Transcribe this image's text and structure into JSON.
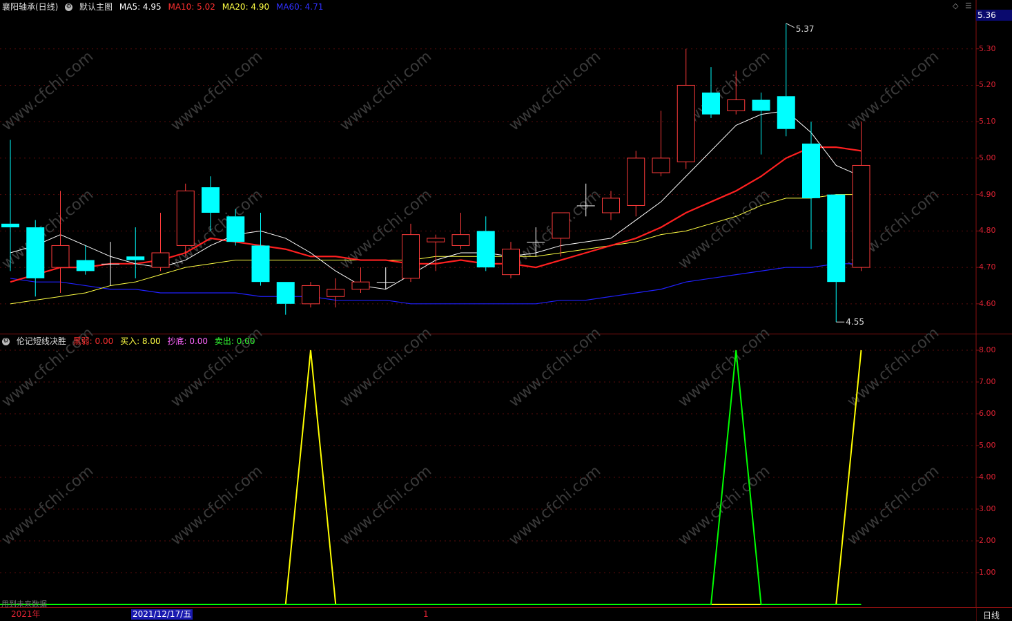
{
  "main_header": {
    "stock_name": "襄阳轴承(日线)",
    "chart_label": "默认主图",
    "ma5": "MA5: 4.95",
    "ma10": "MA10: 5.02",
    "ma20": "MA20: 4.90",
    "ma60": "MA60: 4.71"
  },
  "indicator_header": {
    "name": "伦记短线决胜",
    "black_horse": "黑弱: 0.00",
    "buy": "买入: 8.00",
    "bottom": "抄底: 0.00",
    "sell": "卖出: 0.00"
  },
  "current_price": "5.36",
  "price_ticks": [
    "5.30",
    "5.20",
    "5.10",
    "5.00",
    "4.90",
    "4.80",
    "4.70",
    "4.60"
  ],
  "indicator_ticks": [
    "8.00",
    "7.00",
    "6.00",
    "5.00",
    "4.00",
    "3.00",
    "2.00",
    "1.00"
  ],
  "high_mark": "5.37",
  "low_mark": "4.55",
  "watermark": "www.cfchi.com",
  "footer": {
    "year": "2021年",
    "cursor_date": "2021/12/17/五",
    "month_mark": "1",
    "future_note": "用到未来数据",
    "period": "日线"
  },
  "controls": {
    "diamond": "◇",
    "menu": "☰"
  },
  "colors": {
    "up": "#ff3b3b",
    "down": "#00ffff",
    "ma5": "#ffffff",
    "ma10": "#ff2020",
    "ma20": "#ffff44",
    "ma60": "#2020ff",
    "buy": "#ffff00",
    "sell": "#00ff00",
    "axis": "#8a1010"
  },
  "chart_data": [
    {
      "type": "candlestick",
      "title": "襄阳轴承(日线)",
      "ylim": [
        4.52,
        5.4
      ],
      "candles": [
        {
          "o": 4.82,
          "h": 5.05,
          "l": 4.69,
          "c": 4.81
        },
        {
          "o": 4.81,
          "h": 4.83,
          "l": 4.62,
          "c": 4.67
        },
        {
          "o": 4.7,
          "h": 4.91,
          "l": 4.63,
          "c": 4.76
        },
        {
          "o": 4.72,
          "h": 4.76,
          "l": 4.68,
          "c": 4.69
        },
        {
          "o": 4.71,
          "h": 4.77,
          "l": 4.65,
          "c": 4.71
        },
        {
          "o": 4.73,
          "h": 4.81,
          "l": 4.67,
          "c": 4.72
        },
        {
          "o": 4.7,
          "h": 4.85,
          "l": 4.69,
          "c": 4.74
        },
        {
          "o": 4.76,
          "h": 4.93,
          "l": 4.73,
          "c": 4.91
        },
        {
          "o": 4.92,
          "h": 4.95,
          "l": 4.8,
          "c": 4.85
        },
        {
          "o": 4.84,
          "h": 4.86,
          "l": 4.76,
          "c": 4.77
        },
        {
          "o": 4.76,
          "h": 4.85,
          "l": 4.65,
          "c": 4.66
        },
        {
          "o": 4.66,
          "h": 4.66,
          "l": 4.57,
          "c": 4.6
        },
        {
          "o": 4.6,
          "h": 4.66,
          "l": 4.59,
          "c": 4.65
        },
        {
          "o": 4.62,
          "h": 4.67,
          "l": 4.59,
          "c": 4.64
        },
        {
          "o": 4.64,
          "h": 4.7,
          "l": 4.63,
          "c": 4.66
        },
        {
          "o": 4.66,
          "h": 4.7,
          "l": 4.64,
          "c": 4.66
        },
        {
          "o": 4.67,
          "h": 4.82,
          "l": 4.66,
          "c": 4.79
        },
        {
          "o": 4.77,
          "h": 4.79,
          "l": 4.69,
          "c": 4.78
        },
        {
          "o": 4.76,
          "h": 4.85,
          "l": 4.75,
          "c": 4.79
        },
        {
          "o": 4.8,
          "h": 4.84,
          "l": 4.69,
          "c": 4.7
        },
        {
          "o": 4.68,
          "h": 4.77,
          "l": 4.67,
          "c": 4.75
        },
        {
          "o": 4.77,
          "h": 4.81,
          "l": 4.73,
          "c": 4.77
        },
        {
          "o": 4.78,
          "h": 4.85,
          "l": 4.73,
          "c": 4.85
        },
        {
          "o": 4.87,
          "h": 4.93,
          "l": 4.84,
          "c": 4.87
        },
        {
          "o": 4.85,
          "h": 4.91,
          "l": 4.83,
          "c": 4.89
        },
        {
          "o": 4.87,
          "h": 5.02,
          "l": 4.84,
          "c": 5.0
        },
        {
          "o": 4.96,
          "h": 5.13,
          "l": 4.95,
          "c": 5.0
        },
        {
          "o": 4.99,
          "h": 5.3,
          "l": 4.97,
          "c": 5.2
        },
        {
          "o": 5.18,
          "h": 5.25,
          "l": 5.11,
          "c": 5.12
        },
        {
          "o": 5.13,
          "h": 5.24,
          "l": 5.12,
          "c": 5.16
        },
        {
          "o": 5.16,
          "h": 5.18,
          "l": 5.01,
          "c": 5.13
        },
        {
          "o": 5.17,
          "h": 5.37,
          "l": 5.06,
          "c": 5.08
        },
        {
          "o": 5.04,
          "h": 5.1,
          "l": 4.75,
          "c": 4.89
        },
        {
          "o": 4.9,
          "h": 4.9,
          "l": 4.55,
          "c": 4.66
        },
        {
          "o": 4.7,
          "h": 5.1,
          "l": 4.69,
          "c": 4.98
        }
      ],
      "ma5": [
        4.74,
        4.76,
        4.79,
        4.76,
        4.73,
        4.71,
        4.7,
        4.72,
        4.76,
        4.79,
        4.8,
        4.78,
        4.74,
        4.69,
        4.65,
        4.64,
        4.68,
        4.72,
        4.74,
        4.74,
        4.73,
        4.74,
        4.76,
        4.77,
        4.78,
        4.83,
        4.88,
        4.95,
        5.02,
        5.09,
        5.12,
        5.13,
        5.07,
        4.98,
        4.95
      ],
      "ma10": [
        4.66,
        4.68,
        4.7,
        4.7,
        4.71,
        4.71,
        4.72,
        4.74,
        4.78,
        4.77,
        4.76,
        4.75,
        4.73,
        4.73,
        4.72,
        4.72,
        4.71,
        4.71,
        4.72,
        4.71,
        4.71,
        4.7,
        4.72,
        4.74,
        4.76,
        4.78,
        4.81,
        4.85,
        4.88,
        4.91,
        4.95,
        5.0,
        5.03,
        5.03,
        5.02
      ],
      "ma20": [
        4.6,
        4.61,
        4.62,
        4.63,
        4.65,
        4.66,
        4.68,
        4.7,
        4.71,
        4.72,
        4.72,
        4.72,
        4.72,
        4.72,
        4.72,
        4.72,
        4.72,
        4.73,
        4.73,
        4.73,
        4.73,
        4.73,
        4.74,
        4.75,
        4.76,
        4.77,
        4.79,
        4.8,
        4.82,
        4.84,
        4.87,
        4.89,
        4.89,
        4.9,
        4.9
      ],
      "ma60": [
        4.67,
        4.66,
        4.66,
        4.65,
        4.64,
        4.64,
        4.63,
        4.63,
        4.63,
        4.63,
        4.62,
        4.62,
        4.62,
        4.61,
        4.61,
        4.61,
        4.6,
        4.6,
        4.6,
        4.6,
        4.6,
        4.6,
        4.61,
        4.61,
        4.62,
        4.63,
        4.64,
        4.66,
        4.67,
        4.68,
        4.69,
        4.7,
        4.7,
        4.71,
        4.71
      ]
    },
    {
      "type": "line",
      "title": "伦记短线决胜",
      "ylim": [
        0,
        8.5
      ],
      "series": [
        {
          "name": "买入",
          "values": [
            0,
            0,
            0,
            0,
            0,
            0,
            0,
            0,
            0,
            0,
            0,
            0,
            8,
            0,
            0,
            0,
            0,
            0,
            0,
            0,
            0,
            0,
            0,
            0,
            0,
            0,
            0,
            0,
            0,
            0,
            0,
            0,
            0,
            0,
            8
          ]
        },
        {
          "name": "卖出",
          "values": [
            0,
            0,
            0,
            0,
            0,
            0,
            0,
            0,
            0,
            0,
            0,
            0,
            0,
            0,
            0,
            0,
            0,
            0,
            0,
            0,
            0,
            0,
            0,
            0,
            0,
            0,
            0,
            0,
            0,
            8,
            0,
            0,
            0,
            0,
            0
          ]
        }
      ]
    }
  ]
}
